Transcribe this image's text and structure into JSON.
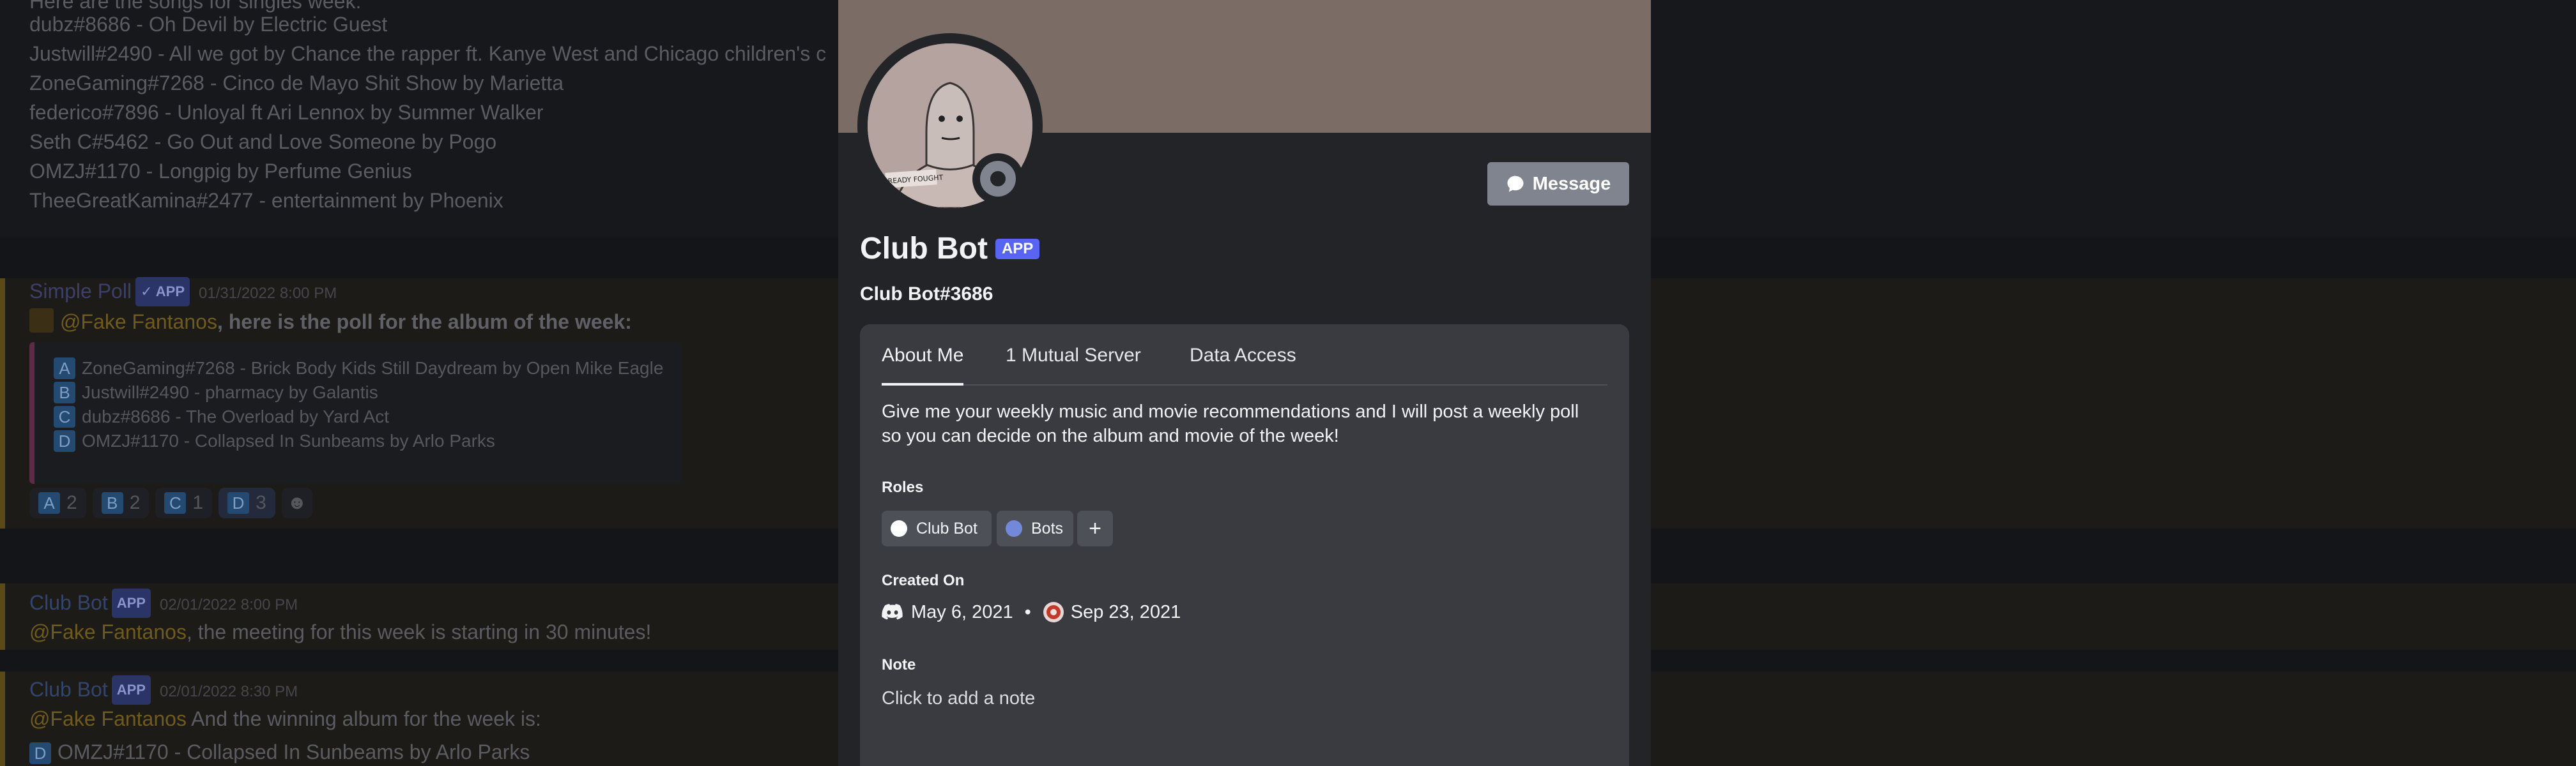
{
  "background_chat": {
    "intro_line": "Here are the songs for singles week:",
    "singles": [
      "dubz#8686 - Oh Devil by Electric Guest",
      "Justwill#2490 - All we got by Chance the rapper ft. Kanye West and Chicago children's c",
      "ZoneGaming#7268 - Cinco de Mayo Shit Show by Marietta",
      "federico#7896 - Unloyal ft Ari Lennox by Summer Walker",
      "Seth C#5462 - Go Out and Love Someone by Pogo",
      "OMZJ#1170 - Longpig by Perfume Genius",
      "TheeGreatKamina#2477 - entertainment by Phoenix"
    ],
    "poll_message": {
      "author": "Simple Poll",
      "app_tag": "✓ APP",
      "timestamp": "01/31/2022 8:00 PM",
      "mention": "@Fake Fantanos",
      "text": ", here is the poll for the album of the week:",
      "options": [
        {
          "letter": "A",
          "text": "ZoneGaming#7268 - Brick Body Kids Still Daydream by Open Mike Eagle"
        },
        {
          "letter": "B",
          "text": "Justwill#2490 - pharmacy by Galantis"
        },
        {
          "letter": "C",
          "text": "dubz#8686 - The Overload by Yard Act"
        },
        {
          "letter": "D",
          "text": "OMZJ#1170 - Collapsed In Sunbeams by Arlo Parks"
        }
      ],
      "reactions": [
        {
          "letter": "A",
          "count": "2"
        },
        {
          "letter": "B",
          "count": "2"
        },
        {
          "letter": "C",
          "count": "1"
        },
        {
          "letter": "D",
          "count": "3"
        }
      ]
    },
    "meeting_message": {
      "author": "Club Bot",
      "app_tag": "APP",
      "timestamp": "02/01/2022 8:00 PM",
      "mention": "@Fake Fantanos",
      "text": ", the meeting for this week is starting in 30 minutes!"
    },
    "winner_message": {
      "author": "Club Bot",
      "app_tag": "APP",
      "timestamp": "02/01/2022 8:30 PM",
      "mention": "@Fake Fantanos",
      "text": " And the winning album for the week is:",
      "winner_letter": "D",
      "winner_text": "OMZJ#1170 - Collapsed In Sunbeams by Arlo Parks"
    }
  },
  "profile": {
    "display_name": "Club Bot",
    "app_badge": "APP",
    "username": "Club Bot#3686",
    "message_button": "Message",
    "avatar_caption": "ALREADY FOUGHT",
    "tabs": [
      "About Me",
      "1 Mutual Server",
      "Data Access"
    ],
    "about_me": "Give me your weekly music and movie recommendations and I will post a weekly poll so you can decide on the album and movie of the week!",
    "roles_heading": "Roles",
    "roles": [
      {
        "name": "Club Bot",
        "color": "#ffffff"
      },
      {
        "name": "Bots",
        "color": "#7289da"
      }
    ],
    "add_role": "+",
    "created_heading": "Created On",
    "discord_created": "May 6, 2021",
    "separator": "•",
    "server_joined": "Sep 23, 2021",
    "note_heading": "Note",
    "note_placeholder": "Click to add a note",
    "colors": {
      "banner": "#7b6d66",
      "modal_bg": "#232428",
      "inner_bg": "#3a3b40",
      "app_badge": "#5865f2",
      "status_offline": "#80848e"
    }
  }
}
